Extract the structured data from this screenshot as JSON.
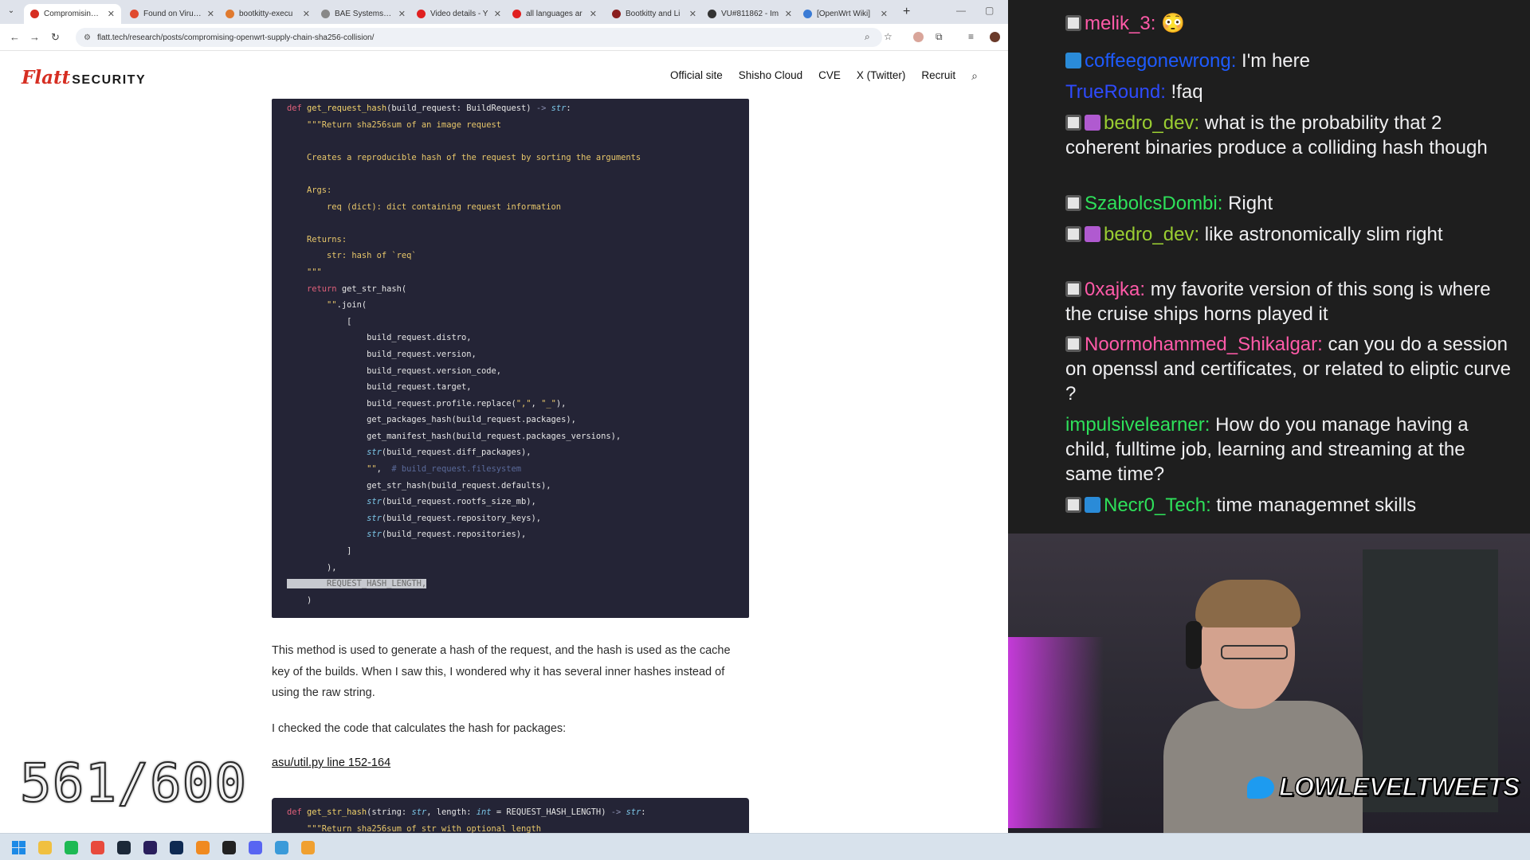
{
  "browser": {
    "tabs": [
      {
        "title": "Compromising O",
        "favicon_color": "#d62e22",
        "active": true
      },
      {
        "title": "Found on VirusTo",
        "favicon_color": "#e04a2f"
      },
      {
        "title": "bootkitty-execu",
        "favicon_color": "#e07a2f"
      },
      {
        "title": "BAE Systems - W",
        "favicon_color": "#888888"
      },
      {
        "title": "Video details - Y",
        "favicon_color": "#e02020"
      },
      {
        "title": "all languages ar",
        "favicon_color": "#e02020"
      },
      {
        "title": "Bootkitty and Li",
        "favicon_color": "#8a1e1e"
      },
      {
        "title": "VU#811862 - Im",
        "favicon_color": "#333333"
      },
      {
        "title": "[OpenWrt Wiki] ",
        "favicon_color": "#3a7bd5"
      }
    ],
    "url": "flatt.tech/research/posts/compromising-openwrt-supply-chain-sha256-collision/"
  },
  "site": {
    "logo_flatt": "Flatt",
    "logo_security": "SECURITY",
    "nav": [
      "Official site",
      "Shisho Cloud",
      "CVE",
      "X (Twitter)",
      "Recruit"
    ]
  },
  "article": {
    "paragraph1": "This method is used to generate a hash of the request, and the hash is used as the cache key of the builds. When I saw this, I wondered why it has several inner hashes instead of using the raw string.",
    "paragraph2": "I checked the code that calculates the hash for packages:",
    "link": "asu/util.py line 152-164"
  },
  "overlay": {
    "counter": "561/600",
    "twitter_handle": "LOWLEVELTWEETS"
  },
  "chat": [
    {
      "user": "melik_3",
      "color": "#ff5aa8",
      "text": "😳",
      "badges": [
        "mod"
      ]
    },
    {
      "user": "coffeegonewrong",
      "color": "#1e5bff",
      "text": "I'm here",
      "badges": [
        "sub"
      ]
    },
    {
      "user": "TrueRound",
      "color": "#2e4bff",
      "text": "!faq",
      "badges": []
    },
    {
      "user": "bedro_dev",
      "color": "#9acd32",
      "text": "what is the probability that 2 coherent binaries produce a colliding hash though",
      "badges": [
        "mod",
        "gift"
      ]
    },
    {
      "user": "SzabolcsDombi",
      "color": "#2ee05a",
      "text": "Right",
      "badges": [
        "mod"
      ]
    },
    {
      "user": "bedro_dev",
      "color": "#9acd32",
      "text": "like astronomically slim right",
      "badges": [
        "mod",
        "gift"
      ]
    },
    {
      "user": "0xajka",
      "color": "#ff5aa8",
      "text": "my favorite version of this song is where the cruise ships horns played it",
      "badges": [
        "mod"
      ]
    },
    {
      "user": "Noormohammed_Shikalgar",
      "color": "#ff5aa8",
      "text": "can you do a session on openssl and certificates, or related to eliptic curve ?",
      "badges": [
        "mod"
      ]
    },
    {
      "user": "impulsivelearner",
      "color": "#2ee05a",
      "text": "How do you manage having a child, fulltime job, learning and streaming at the same time?",
      "badges": []
    },
    {
      "user": "Necr0_Tech",
      "color": "#2ee05a",
      "text": "time managemnet skills",
      "badges": [
        "mod",
        "sub"
      ]
    }
  ],
  "taskbar": {
    "apps": [
      "windows-start",
      "file-explorer",
      "spotify",
      "chrome",
      "steam",
      "premiere",
      "photoshop",
      "vlc",
      "ubisoft",
      "discord",
      "app-blue",
      "sublime"
    ]
  }
}
